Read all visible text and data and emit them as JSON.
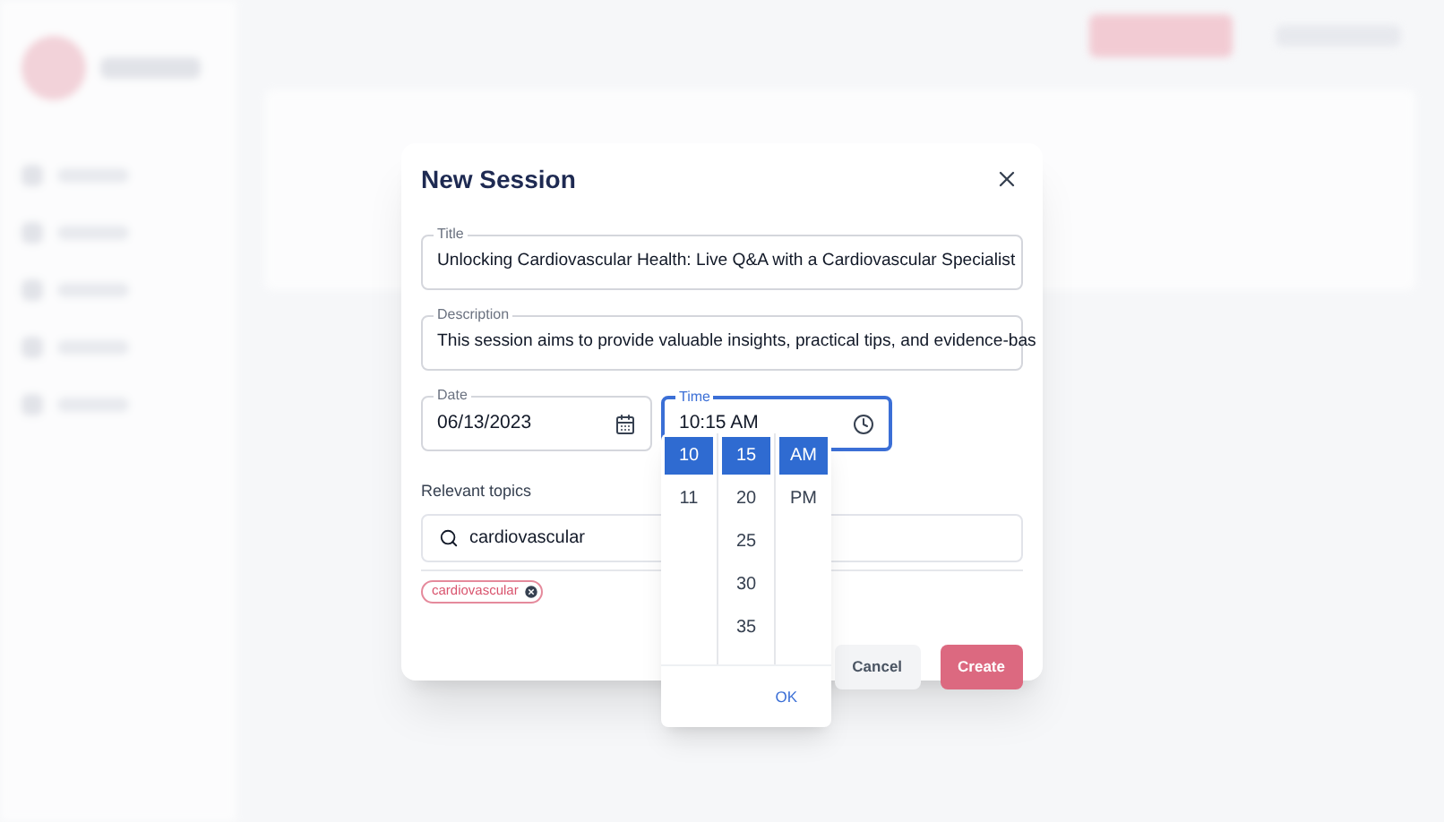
{
  "dialog": {
    "title": "New Session",
    "fields": [
      {
        "label": "Title",
        "value": "Unlocking Cardiovascular Health: Live Q&A with a Cardiovascular Specialist"
      },
      {
        "label": "Description",
        "value": "This session aims to provide valuable insights, practical tips, and evidence-bas"
      }
    ],
    "date": {
      "label": "Date",
      "value": "06/13/2023",
      "focused": false
    },
    "time": {
      "label": "Time",
      "value": "10:15 AM",
      "focused": true
    },
    "topics": {
      "label": "Relevant topics",
      "search_value": "cardiovascular",
      "chips": [
        "cardiovascular"
      ]
    },
    "buttons": [
      {
        "label": "Cancel",
        "kind": "secondary"
      },
      {
        "label": "Create",
        "kind": "primary"
      }
    ]
  },
  "time_picker": {
    "hours": [
      {
        "label": "10",
        "selected": true
      },
      {
        "label": "11",
        "selected": false
      }
    ],
    "minutes": [
      {
        "label": "15",
        "selected": true
      },
      {
        "label": "20",
        "selected": false
      },
      {
        "label": "25",
        "selected": false
      },
      {
        "label": "30",
        "selected": false
      },
      {
        "label": "35",
        "selected": false
      }
    ],
    "periods": [
      {
        "label": "AM",
        "selected": true
      },
      {
        "label": "PM",
        "selected": false
      }
    ],
    "ok": "OK"
  }
}
